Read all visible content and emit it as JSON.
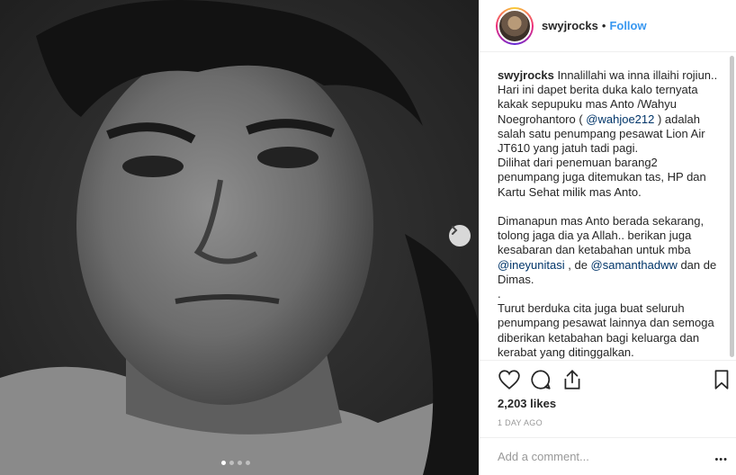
{
  "post": {
    "username": "swyjrocks",
    "separator": "•",
    "follow_label": "Follow"
  },
  "caption": {
    "username": "swyjrocks",
    "text_1": " Innalillahi wa inna illaihi rojiun..\nHari ini dapet berita duka kalo ternyata kakak sepupuku mas Anto /Wahyu Noegrohantoro ( ",
    "mention_1": "@wahjoe212",
    "text_2": " ) adalah salah satu penumpang pesawat Lion Air JT610 yang jatuh tadi pagi.\nDilihat dari penemuan barang2 penumpang juga ditemukan tas, HP dan Kartu Sehat milik mas Anto.\n\nDimanapun mas Anto berada sekarang, tolong jaga dia ya Allah.. berikan juga kesabaran dan ketabahan untuk mba ",
    "mention_2": "@ineyunitasi",
    "text_3": " , de ",
    "mention_3": "@samanthadww",
    "text_4": " dan de Dimas.\n.\nTurut berduka cita juga buat seluruh penumpang pesawat lainnya dan semoga diberikan ketabahan bagi keluarga dan kerabat yang ditinggalkan."
  },
  "stats": {
    "likes": "2,203 likes",
    "time": "1 DAY AGO"
  },
  "comment": {
    "placeholder": "Add a comment...",
    "more_label": "•••"
  },
  "carousel": {
    "slide_count": 4,
    "active_index": 0
  },
  "icons": {
    "like": "heart-icon",
    "comment": "comment-icon",
    "share": "share-icon",
    "save": "bookmark-icon",
    "next": "chevron-right-icon"
  },
  "colors": {
    "accent": "#3897f0",
    "mention": "#003569",
    "text": "#262626",
    "muted": "#999999"
  }
}
